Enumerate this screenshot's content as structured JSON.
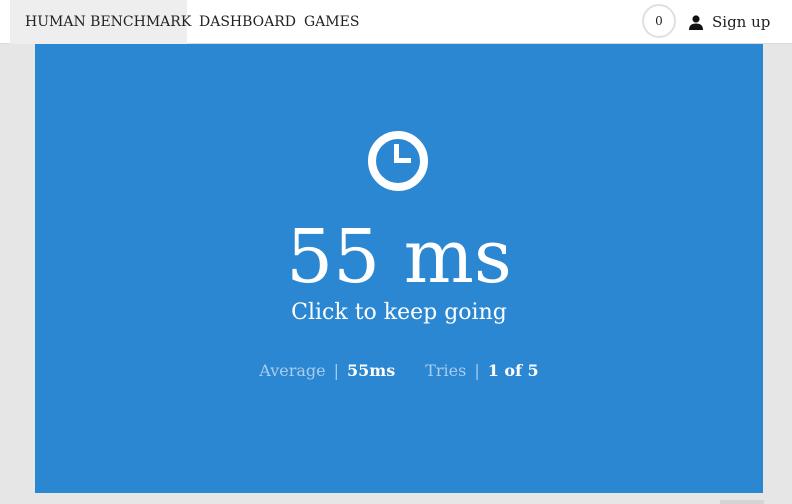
{
  "navbar": {
    "brand_label": "HUMAN BENCHMARK",
    "links": [
      {
        "label": "DASHBOARD"
      },
      {
        "label": "GAMES"
      }
    ],
    "score_badge": "0",
    "signup_label": "Sign up"
  },
  "test": {
    "result": "55 ms",
    "hint": "Click to keep going",
    "average_label": "Average",
    "average_value": "55ms",
    "tries_label": "Tries",
    "tries_value": "1 of 5",
    "separator": "|"
  },
  "colors": {
    "accent_blue": "#2b87d1",
    "stat_label": "#a9cdee",
    "page_bg": "#e6e6e6"
  },
  "icons": {
    "brand": "lightning-bolt-icon",
    "account": "user-icon",
    "result": "clock-icon"
  }
}
